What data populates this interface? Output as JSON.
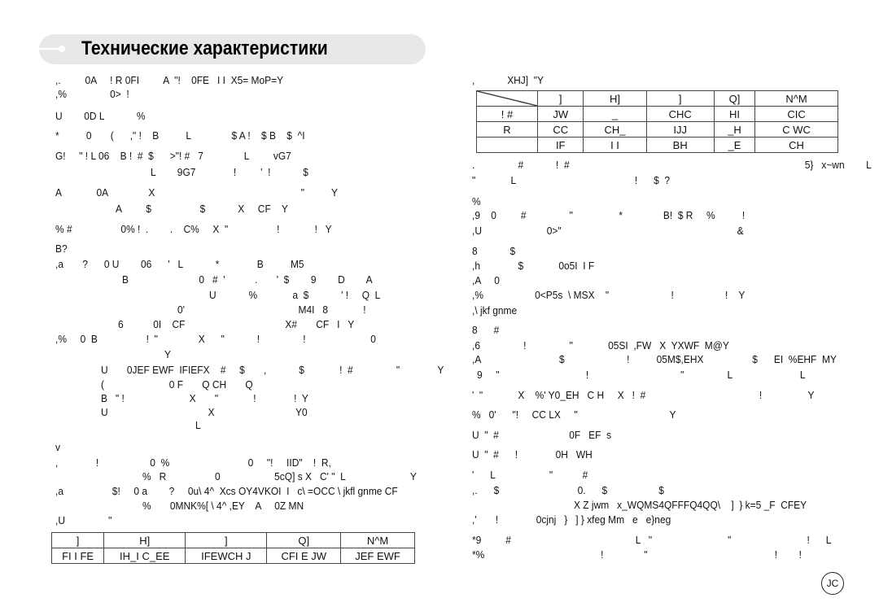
{
  "header": {
    "title": "Технические характеристики"
  },
  "left_lines": [
    ",.         0A     ! R 0FI         A  \"!    0FE   I I  X5= MoP=Y",
    ",%                0>  !",
    "U        0D L            %",
    "*          0       (      ,\" !    B          L               $ A !    $ B    $  ^I",
    "G!     \" ! L 06    B !  #  $      >\"! #   7               L         vG7",
    "L        9G7              !         '  !            $",
    "A             0A               X                                                      \"          Y",
    "A         $                  $            X     CF    Y",
    "% #                  0% !  .        .    C%     X  \"                  !             !   Y",
    "B?",
    ",a       ?      0 U        06      '   L            *              B          M5",
    "B                          0   #  '           .       '  $        9        D        A",
    "U            %             a  $            ' !     Q  L",
    "0'                                          M4I   8             !",
    "6           0I    CF                                     X#       CF   I   Y",
    ",%     0  B                  !  \"               X      \"            !                !                        0",
    "Y",
    "U       0JEF EWF  IFIEFX    #     $       ,            $             !  #                \"              Y",
    "(                        0 F       Q CH       Q",
    "B   \" !                        X       \"             !              !  Y",
    "U                                     X                              Y0",
    "L",
    "v",
    ",              !                   0  %                             0     \"!     IID\"    !  R,",
    "%   R                  0                    5cQ] s X   C' \"  L                        Y",
    ",a                  $!     0 a        ?     0u\\ 4^  Xcs OY4VKOI  I   c\\ =OCC \\ jkfl gnme CF",
    "%       0MNK%[ \\ 4^ ,EY    A     0Z MN",
    ",U                \""
  ],
  "right_lines": [
    ",            XHJ]  \"Y",
    ".                #            !  #                                                                                       5}   x~wn        L",
    "\"             L                                            !      $  ?",
    "%",
    ",9    0         #                \"                 *               B!  $ R     %          !",
    ",U                        0>\"                                                                 &",
    "8            $",
    ",h              $             0o5I  I F",
    ",A     0",
    ",%                   0<P5s  \\ MSX    \"                       !                   !    Y",
    ",\\ jkf gnme",
    "8      #",
    ",6                !                \"             05SI  ,FW   X  YXWF  M@Y",
    ",A                             $                       !          05M$,EHX                  $      EI  %EHF  MY",
    "9     \"                                !                                  \"                L                         L",
    "'  \"             X    %' Y0_EH   C H     X   !  #                                          !                 Y",
    "%   0'      \"!     CC LX     \"                                  Y",
    "U  \"  #                          0F   EF  s",
    "U  \"  #      !              0H   WH",
    "'      L                    \"           #",
    ",.      $                             0.      $                   $",
    "X Z jwm   x_WQMS4QFFFQ4QQ\\    ]  } k=5 _F  CFEY",
    ",'       !              0cjnj   }   ] } xfeg Mm   e   e}neg",
    "*9         #                                              L   \"                            \"                            !      L                  !",
    "*%                                           !               \"                                               !        !"
  ],
  "table_right": {
    "header": [
      "",
      "]",
      "H]",
      "]",
      "Q]",
      "N^M"
    ],
    "rows": [
      [
        "! #",
        "JW",
        "_",
        "CHC",
        "HI",
        "CIC"
      ],
      [
        "R",
        "CC",
        "CH_",
        "IJJ",
        "_H",
        "C WC"
      ],
      [
        "",
        "IF",
        "I I",
        "BH",
        "_E",
        "CH"
      ]
    ]
  },
  "table_left": {
    "header": [
      "]",
      "H]",
      "]",
      "Q]",
      "N^M"
    ],
    "rows": [
      [
        "FI I FE",
        "IH_I C_EE",
        "IFEWCH J",
        "CFI E JW",
        "JEF EWF"
      ]
    ]
  },
  "page_number": "JC"
}
